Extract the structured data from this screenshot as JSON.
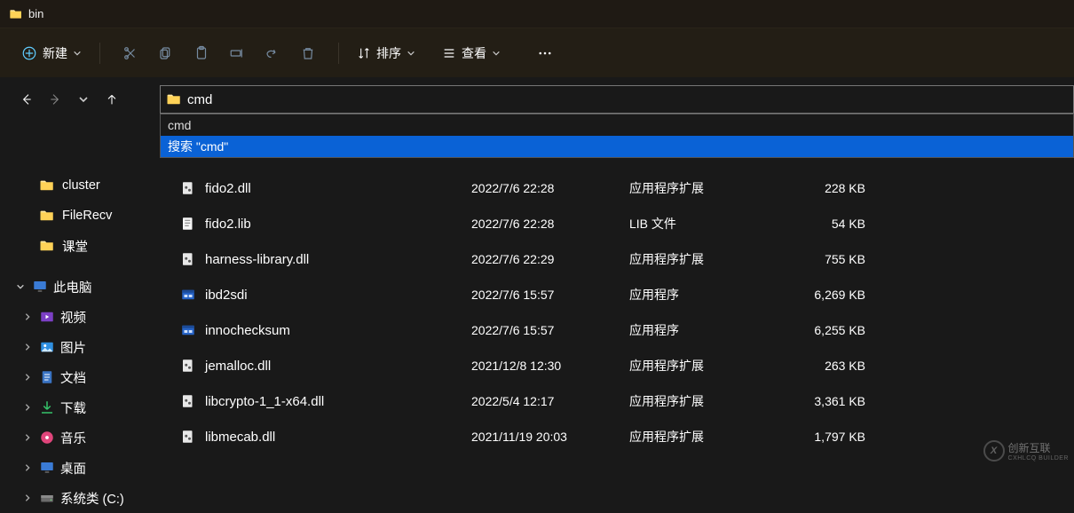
{
  "title": "bin",
  "toolbar": {
    "new_label": "新建",
    "sort_label": "排序",
    "view_label": "查看"
  },
  "address": {
    "value": "cmd",
    "suggest_plain": "cmd",
    "suggest_search": "搜索 \"cmd\""
  },
  "sidebar": {
    "items": [
      {
        "label": "cluster",
        "icon": "folder",
        "indent": "sub"
      },
      {
        "label": "FileRecv",
        "icon": "folder",
        "indent": "sub"
      },
      {
        "label": "课堂",
        "icon": "folder",
        "indent": "sub"
      }
    ],
    "pc_header": "此电脑",
    "pc_children": [
      {
        "label": "视频",
        "icon": "videos"
      },
      {
        "label": "图片",
        "icon": "pictures"
      },
      {
        "label": "文档",
        "icon": "documents"
      },
      {
        "label": "下载",
        "icon": "downloads"
      },
      {
        "label": "音乐",
        "icon": "music"
      },
      {
        "label": "桌面",
        "icon": "desktop"
      },
      {
        "label": "系统类 (C:)",
        "icon": "drive"
      }
    ]
  },
  "files": [
    {
      "name": "fido2.dll",
      "date": "2022/7/6 22:28",
      "type": "应用程序扩展",
      "size": "228 KB",
      "icon": "dll"
    },
    {
      "name": "fido2.lib",
      "date": "2022/7/6 22:28",
      "type": "LIB 文件",
      "size": "54 KB",
      "icon": "lib"
    },
    {
      "name": "harness-library.dll",
      "date": "2022/7/6 22:29",
      "type": "应用程序扩展",
      "size": "755 KB",
      "icon": "dll"
    },
    {
      "name": "ibd2sdi",
      "date": "2022/7/6 15:57",
      "type": "应用程序",
      "size": "6,269 KB",
      "icon": "exe"
    },
    {
      "name": "innochecksum",
      "date": "2022/7/6 15:57",
      "type": "应用程序",
      "size": "6,255 KB",
      "icon": "exe"
    },
    {
      "name": "jemalloc.dll",
      "date": "2021/12/8 12:30",
      "type": "应用程序扩展",
      "size": "263 KB",
      "icon": "dll"
    },
    {
      "name": "libcrypto-1_1-x64.dll",
      "date": "2022/5/4 12:17",
      "type": "应用程序扩展",
      "size": "3,361 KB",
      "icon": "dll"
    },
    {
      "name": "libmecab.dll",
      "date": "2021/11/19 20:03",
      "type": "应用程序扩展",
      "size": "1,797 KB",
      "icon": "dll"
    }
  ],
  "colors": {
    "highlight": "#0a62d6",
    "toolbar_bg": "#231e15",
    "accent_blue": "#60cdff"
  },
  "watermark": {
    "brand": "创新互联",
    "sub": "CXHLCQ BUILDER"
  }
}
